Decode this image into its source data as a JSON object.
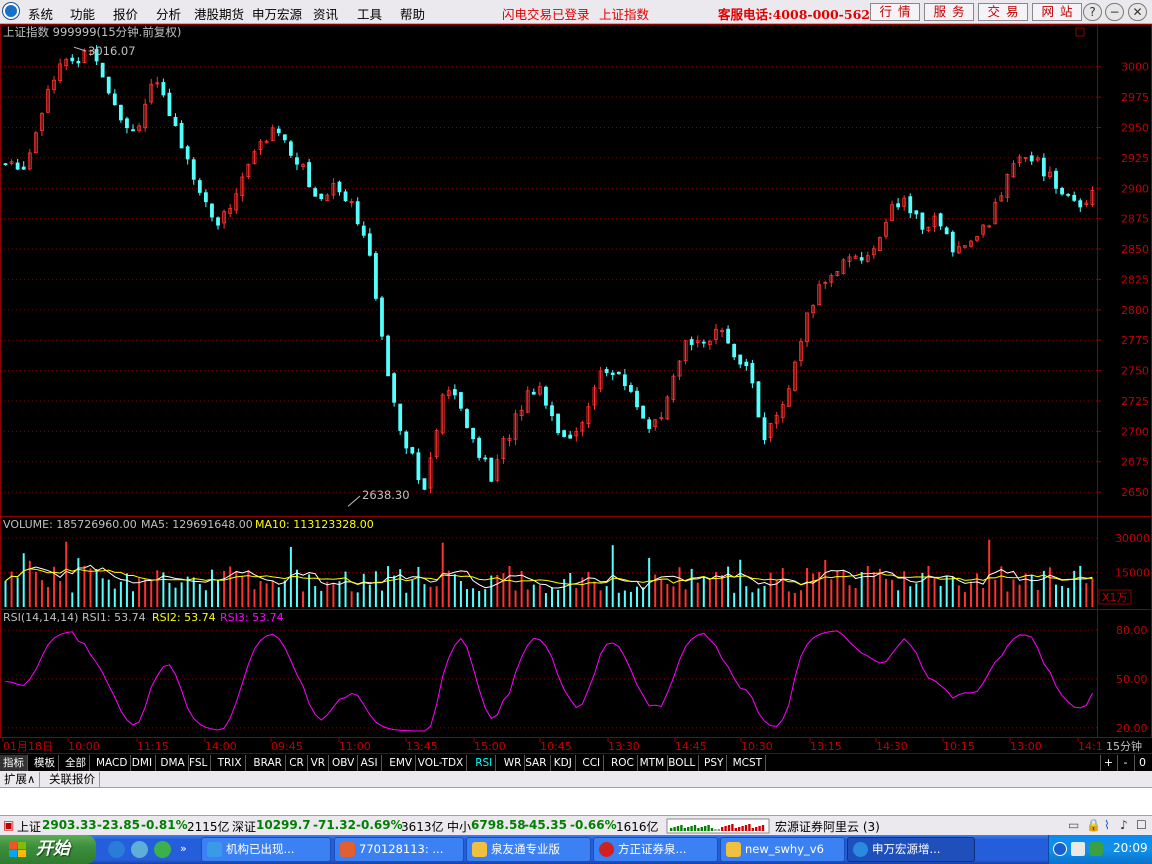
{
  "menu": [
    "系统",
    "功能",
    "报价",
    "分析",
    "港股期货",
    "申万宏源",
    "资讯",
    "工具",
    "帮助"
  ],
  "status_text": {
    "login": "闪电交易已登录",
    "index": "上证指数"
  },
  "hotline": "客服电话:4008-000-562",
  "top_buttons": [
    "行情",
    "服务",
    "交易",
    "网站"
  ],
  "window_buttons": [
    "?",
    "−",
    "❐",
    "✕"
  ],
  "chart_title": "上证指数 999999(15分钟.前复权)",
  "chart_data": {
    "type": "candlestick",
    "price_axis": [
      "3000",
      "2975",
      "2950",
      "2925",
      "2900",
      "2875",
      "2850",
      "2825",
      "2800",
      "2775",
      "2750",
      "2725",
      "2700",
      "2675",
      "2650"
    ],
    "ylim": [
      2632,
      3022
    ],
    "high_label": "3016.07",
    "low_label": "2638.30",
    "volume_header": {
      "label": "VOLUME: 185726960.00",
      "ma5": "MA5: 129691648.00",
      "ma10": "MA10: 113123328.00"
    },
    "volume_axis": [
      "30000",
      "15000"
    ],
    "volume_unit": "X1万",
    "rsi_header": {
      "label": "RSI(14,14,14)",
      "rsi1": "RSI1: 53.74",
      "rsi2": "RSI2: 53.74",
      "rsi3": "RSI3: 53.74"
    },
    "rsi_axis": [
      "80.00",
      "50.00",
      "20.00"
    ],
    "time_axis": [
      "01月18日",
      "10:00",
      "11:15",
      "14:00",
      "09:45",
      "11:00",
      "13:45",
      "15:00",
      "10:45",
      "13:30",
      "14:45",
      "10:30",
      "13:15",
      "14:30",
      "10:15",
      "13:00",
      "14:1"
    ],
    "period": "15分钟",
    "close_path": [
      2920,
      2915,
      2925,
      2960,
      2990,
      3005,
      3000,
      3015,
      3010,
      2985,
      2965,
      2945,
      2960,
      2990,
      2970,
      2950,
      2930,
      2900,
      2880,
      2870,
      2890,
      2910,
      2930,
      2940,
      2950,
      2935,
      2920,
      2900,
      2890,
      2905,
      2895,
      2880,
      2850,
      2790,
      2740,
      2700,
      2680,
      2650,
      2700,
      2740,
      2720,
      2700,
      2680,
      2660,
      2690,
      2710,
      2730,
      2740,
      2720,
      2700,
      2690,
      2710,
      2740,
      2750,
      2745,
      2735,
      2720,
      2700,
      2710,
      2740,
      2770,
      2780,
      2775,
      2780,
      2770,
      2760,
      2740,
      2690,
      2710,
      2730,
      2760,
      2800,
      2820,
      2830,
      2840,
      2850,
      2835,
      2860,
      2880,
      2890,
      2880,
      2870,
      2875,
      2860,
      2850,
      2855,
      2860,
      2875,
      2900,
      2915,
      2925,
      2930,
      2910,
      2900,
      2890,
      2885,
      2900
    ]
  },
  "indicator_tabs": [
    "指标",
    "模板",
    "全部",
    "MACD",
    "DMI",
    "DMA",
    "FSL",
    "TRIX",
    "BRAR",
    "CR",
    "VR",
    "OBV",
    "ASI",
    "EMV",
    "VOL-TDX",
    "RSI",
    "WR",
    "SAR",
    "KDJ",
    "CCI",
    "ROC",
    "MTM",
    "BOLL",
    "PSY",
    "MCST"
  ],
  "tab_controls": [
    "+",
    "-",
    "0"
  ],
  "ext_tabs": [
    "扩展∧",
    "关联报价"
  ],
  "status_bar": {
    "sh_label": "上证",
    "sh_price": "2903.33",
    "sh_chg": "-23.85",
    "sh_pct": "-0.81%",
    "sh_amt": "2115亿",
    "sz_label": "深证",
    "sz_price": "10299.7",
    "sz_chg": "-71.32",
    "sz_pct": "-0.69%",
    "sz_amt": "3613亿",
    "zx_label": "中小",
    "zx_price": "6798.58",
    "zx_chg": "-45.35",
    "zx_pct": "-0.66%",
    "zx_amt": "1616亿",
    "server": "宏源证券阿里云 (3)"
  },
  "taskbar": {
    "start": "开始",
    "items": [
      "机构已出现...",
      "770128113: ...",
      "泉友通专业版",
      "方正证券泉...",
      "new_swhy_v6",
      "申万宏源增..."
    ],
    "clock": "20:09"
  },
  "colors": {
    "up": "#ff3232",
    "down": "#54ffff",
    "grid": "#8b0000",
    "axis_text": "#c00000",
    "white": "#ffffff",
    "yellow": "#ffff00",
    "magenta": "#ff00ff"
  }
}
